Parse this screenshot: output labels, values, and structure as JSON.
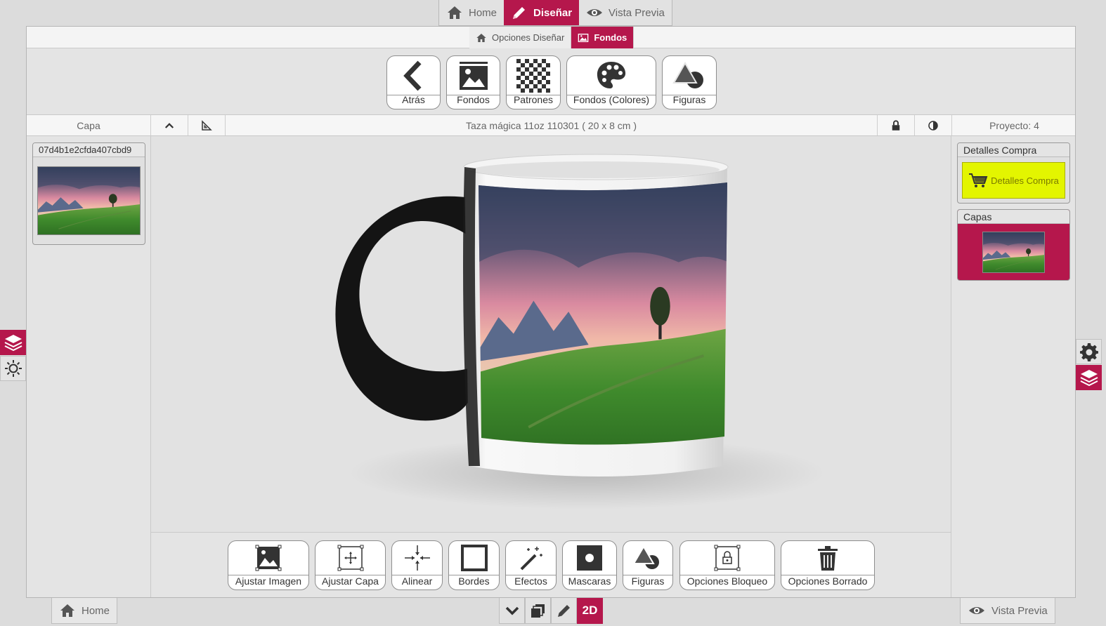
{
  "top_nav": {
    "home": "Home",
    "design": "Diseñar",
    "preview": "Vista Previa"
  },
  "sub_nav": {
    "design_options": "Opciones Diseñar",
    "backgrounds": "Fondos"
  },
  "toolbar": {
    "back": "Atrás",
    "backgrounds": "Fondos",
    "patterns": "Patrones",
    "color_backgrounds": "Fondos (Colores)",
    "shapes": "Figuras"
  },
  "info_bar": {
    "layer_label": "Capa",
    "product_title": "Taza mágica 11oz 110301 ( 20 x 8 cm )",
    "project_label": "Proyecto: 4"
  },
  "layers": [
    {
      "id": "07d4b1e2cfda407cbd9"
    }
  ],
  "right_panel": {
    "purchase_header": "Detalles Compra",
    "purchase_button": "Detalles Compra",
    "layers_header": "Capas"
  },
  "bottom_tools": {
    "adjust_image": "Ajustar Imagen",
    "adjust_layer": "Ajustar Capa",
    "align": "Alinear",
    "borders": "Bordes",
    "effects": "Efectos",
    "masks": "Mascaras",
    "shapes": "Figuras",
    "lock_options": "Opciones Bloqueo",
    "delete_options": "Opciones Borrado"
  },
  "bottom_bar": {
    "home": "Home",
    "preview": "Vista Previa",
    "mode": "2D"
  },
  "colors": {
    "accent": "#b5174c",
    "buy_button": "#e3f500"
  },
  "icons": {
    "home": "house-icon",
    "design": "pencil-icon",
    "preview": "eye-icon",
    "backgrounds": "image-icon",
    "patterns": "checkerboard-icon",
    "color_backgrounds": "palette-icon",
    "shapes": "shapes-icon",
    "lock": "lock-icon",
    "contrast": "contrast-icon",
    "cart": "cart-icon",
    "layers": "layers-icon",
    "settings": "gear-icon",
    "brightness": "sun-icon"
  }
}
